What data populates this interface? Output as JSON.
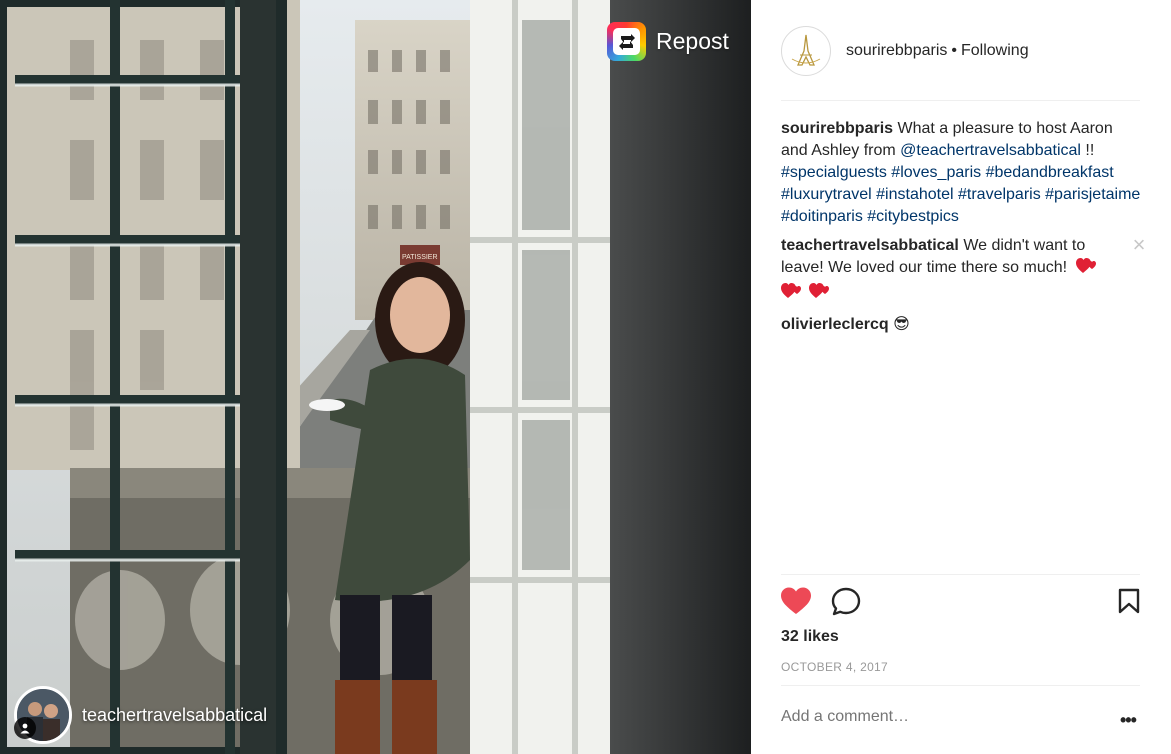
{
  "photo": {
    "repost_label": "Repost",
    "credit_username": "teachertravelsabbatical",
    "storefront_sign": "PATISSIER"
  },
  "post": {
    "owner": "sourirebbparis",
    "separator": "•",
    "follow_status": "Following",
    "caption": {
      "user": "sourirebbparis",
      "text_before": " What a pleasure to host Aaron and Ashley from ",
      "mention": "@teachertravelsabbatical",
      "text_after": " !! ",
      "hashtags": [
        "#specialguests",
        "#loves_paris",
        "#bedandbreakfast",
        "#luxurytravel",
        "#instahotel",
        "#travelparis",
        "#parisjetaime",
        "#doitinparis",
        "#citybestpics"
      ]
    },
    "comments": [
      {
        "user": "teachertravelsabbatical",
        "text": " We didn't want to leave! We loved our time there so much! ",
        "emoji_count": 3
      },
      {
        "user": "olivierleclercq",
        "text": " 😎"
      }
    ],
    "likes": "32 likes",
    "date": "OCTOBER 4, 2017",
    "comment_placeholder": "Add a comment…",
    "more_label": "•••",
    "close_label": "×"
  },
  "colors": {
    "like_red": "#ed4956",
    "link_blue": "#003569",
    "muted": "#999999",
    "divider": "#efefef"
  },
  "icons": [
    "repost-icon",
    "user-tag-icon",
    "heart-icon",
    "comment-bubble-icon",
    "bookmark-icon",
    "close-icon",
    "more-options-icon"
  ]
}
